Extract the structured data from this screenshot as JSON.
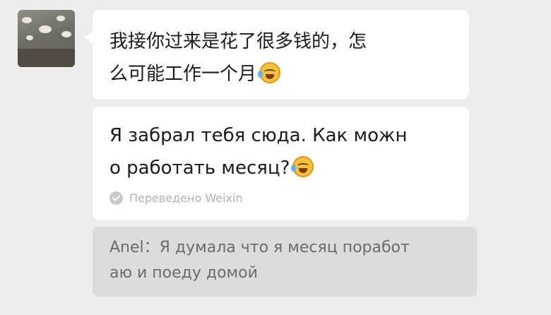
{
  "message": {
    "line1": "我接你过来是花了很多钱的，怎",
    "line2": "么可能工作一个月",
    "emoji": "laughing-crying-emoji"
  },
  "translation": {
    "line1": "Я забрал тебя сюда. Как можн",
    "line2": "о работать месяц?",
    "emoji": "laughing-crying-emoji",
    "translated_by": "Переведено Weixin"
  },
  "quoted_reply": {
    "line1": "Anel：Я думала что я месяц поработ",
    "line2": "аю и поеду домой"
  },
  "colors": {
    "background": "#ededed",
    "bubble": "#ffffff",
    "quote_background": "#dcdcdc"
  }
}
